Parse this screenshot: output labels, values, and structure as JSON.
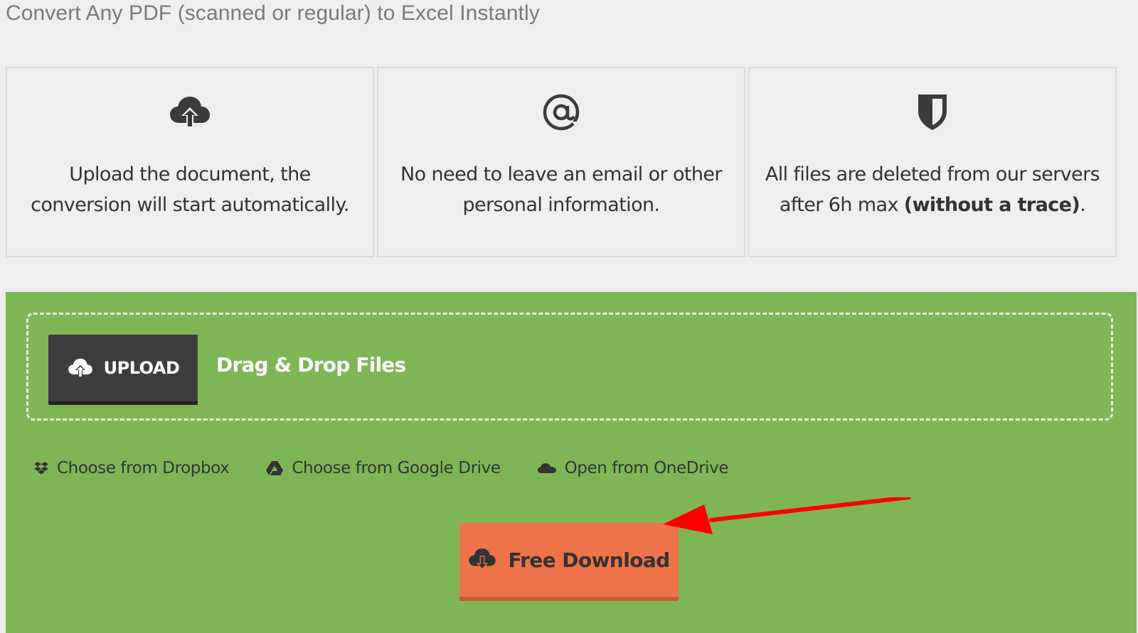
{
  "page": {
    "title": "Convert Any PDF (scanned or regular) to Excel Instantly"
  },
  "features": [
    {
      "icon": "cloud-upload-icon",
      "text": "Upload the document, the conversion will start automatically.",
      "bold_suffix": "",
      "tail": ""
    },
    {
      "icon": "at-sign-icon",
      "text": "No need to leave an email or other personal information.",
      "bold_suffix": "",
      "tail": ""
    },
    {
      "icon": "shield-icon",
      "text": "All files are deleted from our servers after 6h max ",
      "bold_suffix": "(without a trace)",
      "tail": "."
    }
  ],
  "uploader": {
    "upload_label": "UPLOAD",
    "drag_label": "Drag & Drop Files",
    "sources": [
      {
        "icon": "dropbox-icon",
        "label": "Choose from Dropbox"
      },
      {
        "icon": "google-drive-icon",
        "label": "Choose from Google Drive"
      },
      {
        "icon": "onedrive-icon",
        "label": "Open from OneDrive"
      }
    ],
    "download_label": "Free Download"
  },
  "colors": {
    "background": "#efefef",
    "panel_green": "#7fb655",
    "upload_button": "#3d3d3d",
    "download_button": "#ef7349",
    "annotation_arrow": "#ff0000"
  }
}
